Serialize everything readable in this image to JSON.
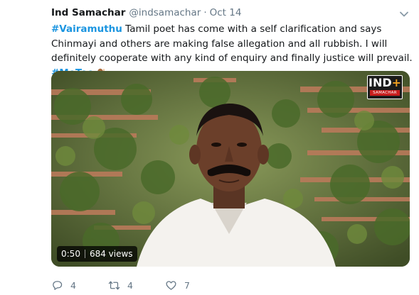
{
  "tweet": {
    "author_name": "Ind Samachar",
    "author_handle": "@indsamachar",
    "separator": "·",
    "date": "Oct 14",
    "text": {
      "hashtag_subject": "#Vairamuthu",
      "body": " Tamil poet has come with a self clarification and says Chinmayi and others are making false allegation and all rubbish. I will definitely cooperate with any kind of enquiry and finally justice will prevail. ",
      "hashtag_metoo": "#MeToo"
    }
  },
  "media": {
    "duration": "0:50",
    "views": "684 views",
    "channel_logo": {
      "main": "IND",
      "plus": "+",
      "sub": "SAMACHAR"
    }
  },
  "actions": {
    "replies": "4",
    "retweets": "4",
    "likes": "7"
  },
  "icons": {
    "caret": "chevron-down-icon",
    "reply": "reply-icon",
    "retweet": "retweet-icon",
    "like": "heart-icon",
    "emoji": "woman-raising-hand-emoji"
  },
  "colors": {
    "hashtag": "#1b95e0",
    "secondary_text": "#657786",
    "primary_text": "#14171a"
  }
}
